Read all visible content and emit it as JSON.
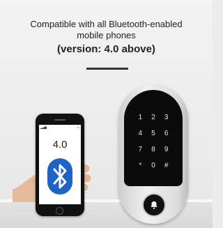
{
  "header": {
    "line1": "Compatible with all Bluetooth-enabled",
    "line2": "mobile phones",
    "line3": "(version: 4.0 above)"
  },
  "phone": {
    "version_label": "4.0",
    "icon": "bluetooth-icon"
  },
  "reader": {
    "keys": [
      "1",
      "2",
      "3",
      "4",
      "5",
      "6",
      "7",
      "8",
      "9",
      "*",
      "0",
      "#"
    ],
    "bell_icon": "bell-icon"
  },
  "colors": {
    "bluetooth_blue": "#1e63c6",
    "reader_face": "#0b0b0b",
    "text": "#222222"
  }
}
